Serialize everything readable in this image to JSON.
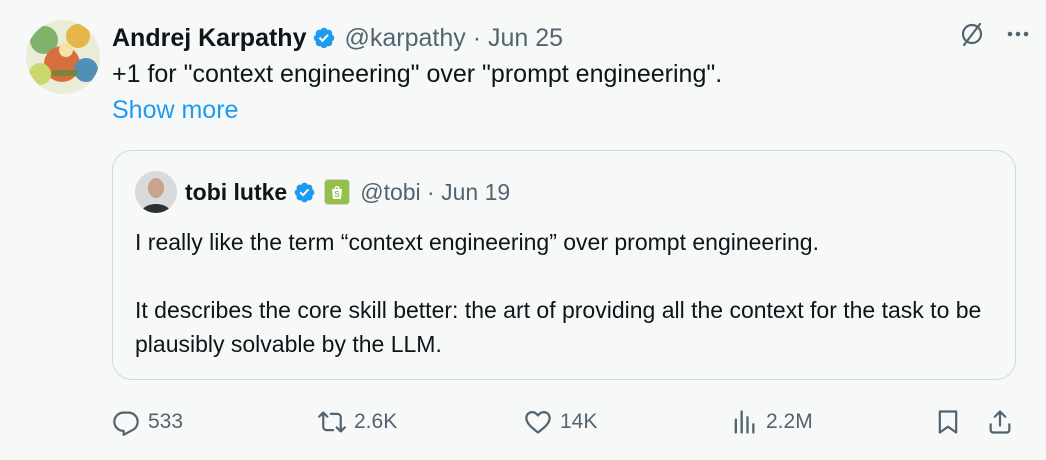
{
  "author": {
    "name": "Andrej Karpathy",
    "handle": "@karpathy",
    "date": "Jun 25",
    "handle_line": "@karpathy · Jun 25",
    "avatar_icon": "colorful-illustration-avatar"
  },
  "tweet": {
    "text": "+1 for \"context engineering\" over \"prompt engineering\".",
    "show_more": "Show more"
  },
  "quote": {
    "name": "tobi lutke",
    "handle_line": "@tobi · Jun 19",
    "avatar_icon": "person-avatar",
    "affiliate_badge_icon": "shopify-bag-icon",
    "paragraphs": [
      "I really like the term “context engineering” over prompt engineering.",
      "It describes the core skill better: the art of providing all the context for the task to be plausibly solvable by the LLM."
    ]
  },
  "actions": {
    "replies": "533",
    "reposts": "2.6K",
    "likes": "14K",
    "views": "2.2M"
  },
  "colors": {
    "background": "#f7f9f9",
    "text": "#0f1419",
    "secondary": "#536471",
    "link": "#1d9bf0",
    "verified": "#1d9bf0",
    "border": "#cfd9de",
    "shopify": "#95bf47"
  }
}
